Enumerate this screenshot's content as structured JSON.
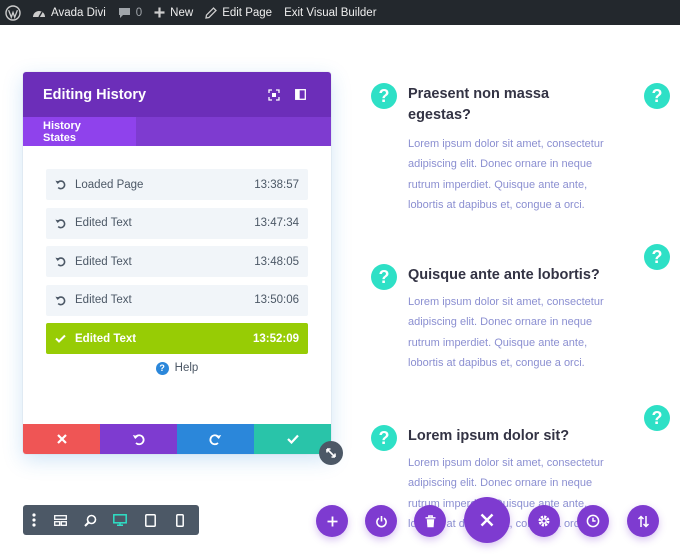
{
  "admin_bar": {
    "site_name": "Avada Divi",
    "comments_count": "0",
    "new_label": "New",
    "edit_page_label": "Edit Page",
    "exit_label": "Exit Visual Builder"
  },
  "history_modal": {
    "title": "Editing History",
    "tab_label": "History States",
    "states": [
      {
        "label": "Loaded Page",
        "time": "13:38:57",
        "active": false
      },
      {
        "label": "Edited Text",
        "time": "13:47:34",
        "active": false
      },
      {
        "label": "Edited Text",
        "time": "13:48:05",
        "active": false
      },
      {
        "label": "Edited Text",
        "time": "13:50:06",
        "active": false
      },
      {
        "label": "Edited Text",
        "time": "13:52:09",
        "active": true
      }
    ],
    "help_label": "Help",
    "help_icon_glyph": "?"
  },
  "blurbs": [
    {
      "title": "Praesent non massa egestas?",
      "text": "Lorem ipsum dolor sit amet, consectetur adipiscing elit. Donec ornare in neque rutrum imperdiet. Quisque ante ante, lobortis at dapibus et, congue a orci."
    },
    {
      "title": "Quisque ante ante lobortis?",
      "text": "Lorem ipsum dolor sit amet, consectetur adipiscing elit. Donec ornare in neque rutrum imperdiet. Quisque ante ante, lobortis at dapibus et, congue a orci."
    },
    {
      "title": "Lorem ipsum dolor sit?",
      "text": "Lorem ipsum dolor sit amet, consectetur adipiscing elit. Donec ornare in neque rutrum imperdiet. Quisque ante ante, lobortis at dapibus et, congue a orci."
    }
  ],
  "question_glyph": "?",
  "colors": {
    "purple": "#7e3bd0",
    "header_purple": "#6c2eb9",
    "active_green": "#97cc05",
    "teal": "#2ee0c6",
    "cancel_red": "#ef5555",
    "redo_blue": "#2b87da",
    "save_teal": "#29c4a9"
  },
  "icons": {
    "admin_bar": [
      "wordpress-icon",
      "comment-icon",
      "plus-icon",
      "pencil-icon"
    ],
    "modal_header": [
      "expand-icon",
      "sidebar-icon"
    ],
    "footer": [
      "close-icon",
      "undo-icon",
      "redo-icon",
      "check-icon"
    ],
    "view_bar": [
      "menu-dots-icon",
      "layers-icon",
      "zoom-icon",
      "desktop-icon",
      "tablet-icon",
      "phone-icon"
    ],
    "page_actions": [
      "add-icon",
      "power-icon",
      "trash-icon",
      "close-icon",
      "settings-icon",
      "history-icon",
      "sort-icon"
    ]
  }
}
